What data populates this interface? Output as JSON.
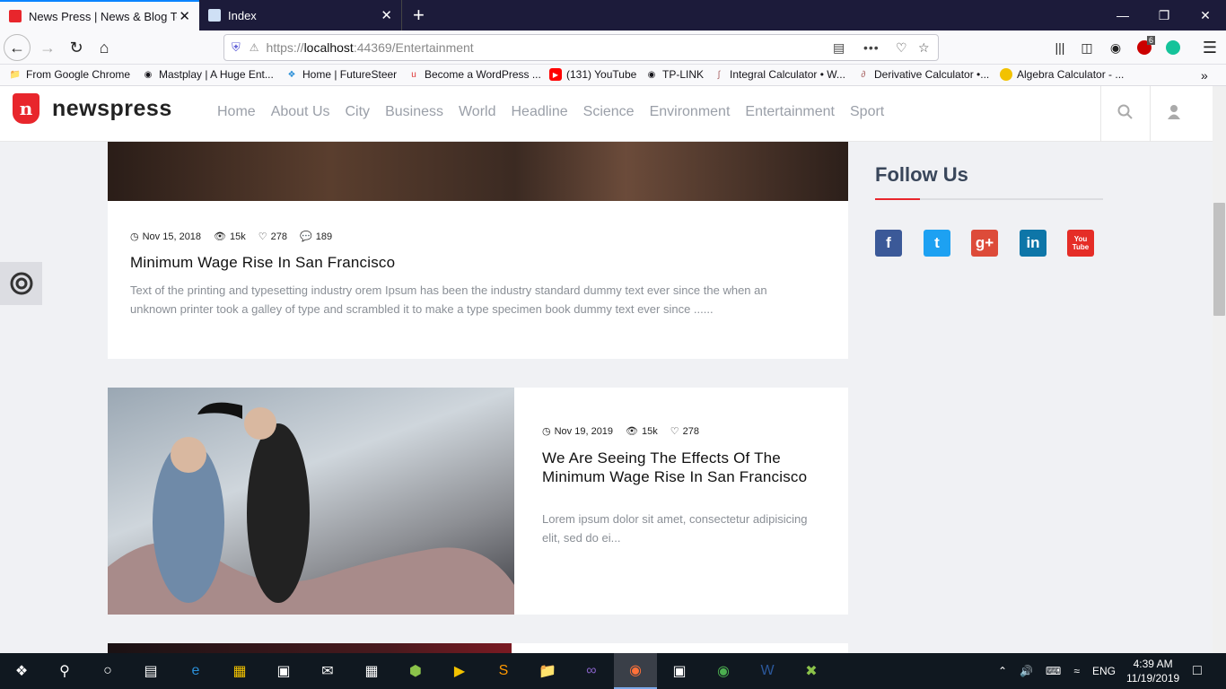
{
  "browser": {
    "tabs": [
      {
        "title": "News Press | News & Blog Temp",
        "close": "✕"
      },
      {
        "title": "Index",
        "close": "✕"
      }
    ],
    "new_tab": "+",
    "url_prefix": "https://",
    "url_host": "localhost",
    "url_rest": ":44369/Entertainment",
    "ext_badge": "6",
    "bookmarks": [
      "From Google Chrome",
      "Mastplay | A Huge Ent...",
      "Home | FutureSteer",
      "Become a WordPress ...",
      "(131) YouTube",
      "TP-LINK",
      "Integral Calculator • W...",
      "Derivative Calculator •...",
      "Algebra Calculator - ..."
    ]
  },
  "site": {
    "logo_letter": "n",
    "logo_text": "newspress",
    "menu": [
      "Home",
      "About Us",
      "City",
      "Business",
      "World",
      "Headline",
      "Science",
      "Environment",
      "Entertainment",
      "Sport"
    ]
  },
  "posts": [
    {
      "date": "Nov 15, 2018",
      "views": "15k",
      "likes": "278",
      "comments": "189",
      "title": "Minimum Wage Rise In San Francisco",
      "excerpt": "Text of the printing and typesetting industry orem Ipsum has been the industry standard dummy text ever since the when an unknown printer took a galley of type and scrambled it to make a type specimen book dummy text ever since ......"
    },
    {
      "date": "Nov 19, 2019",
      "views": "15k",
      "likes": "278",
      "title": "We Are Seeing The Effects Of The Minimum Wage Rise In San Francisco",
      "excerpt": "Lorem ipsum dolor sit amet, consectetur adipisicing elit, sed do ei..."
    }
  ],
  "sidebar": {
    "follow_title": "Follow Us",
    "social": [
      {
        "name": "facebook",
        "glyph": "f",
        "color": "#3b5998"
      },
      {
        "name": "twitter",
        "glyph": "t",
        "color": "#1da1f2"
      },
      {
        "name": "google-plus",
        "glyph": "g+",
        "color": "#dd4b39"
      },
      {
        "name": "linkedin",
        "glyph": "in",
        "color": "#0e76a8"
      },
      {
        "name": "youtube",
        "glyph": "You Tube",
        "color": "#e52d27"
      }
    ]
  },
  "taskbar": {
    "time": "4:39 AM",
    "date": "11/19/2019",
    "lang": "ENG"
  },
  "colors": {
    "accent": "#e8262c",
    "tabbar": "#1c1b3a",
    "taskbar": "#101820"
  }
}
